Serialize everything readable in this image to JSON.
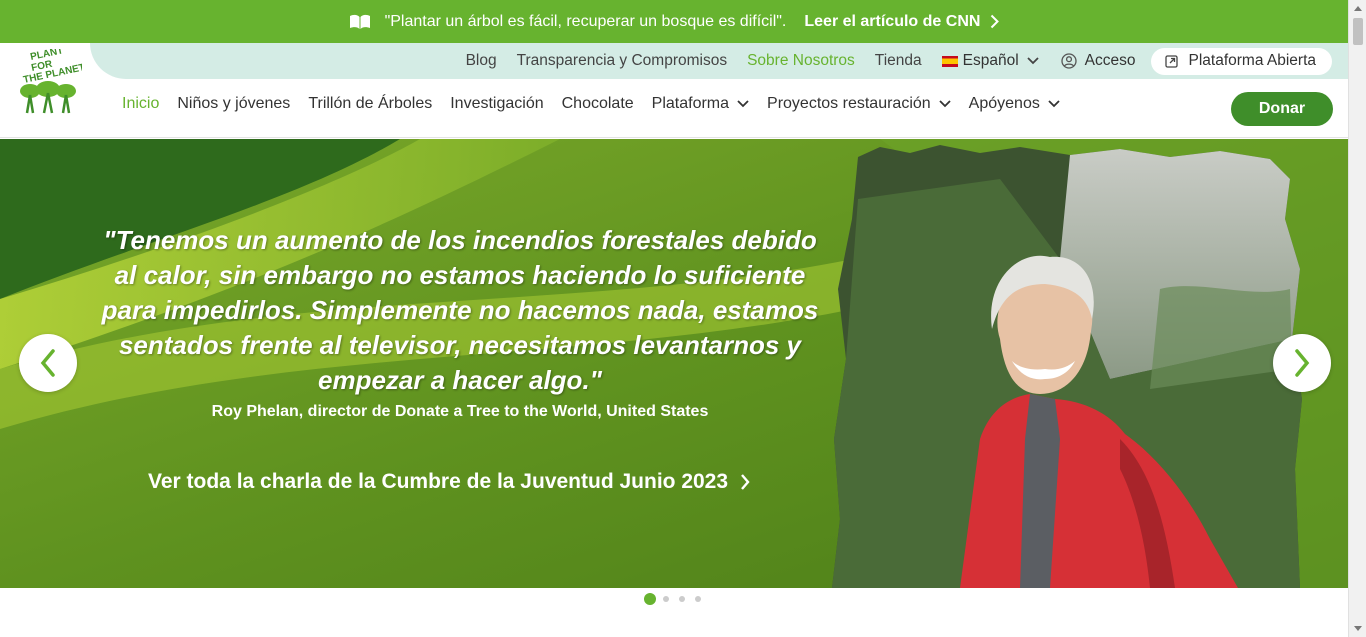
{
  "topbar": {
    "quote": "\"Plantar un árbol es fácil, recuperar un bosque es difícil\".",
    "cta": "Leer el artículo de CNN"
  },
  "header": {
    "logo_text": "PLANT FOR THE PLANET",
    "utility": {
      "blog": "Blog",
      "transparency": "Transparencia y Compromisos",
      "about": "Sobre Nosotros",
      "shop": "Tienda",
      "language": "Español",
      "login": "Acceso",
      "platform": "Plataforma Abierta"
    },
    "nav": {
      "home": "Inicio",
      "kids": "Niños y jóvenes",
      "trillion": "Trillón de Árboles",
      "research": "Investigación",
      "chocolate": "Chocolate",
      "platform": "Plataforma",
      "projects": "Proyectos restauración",
      "support": "Apóyenos"
    },
    "donate": "Donar"
  },
  "hero": {
    "quote_lines": [
      "\"Tenemos un aumento de los incendios forestales debido",
      "al calor, sin embargo no estamos haciendo lo suficiente",
      "para impedirlos. Simplemente no hacemos nada, estamos",
      "sentados frente al televisor, necesitamos levantarnos y",
      "empezar a hacer algo.\""
    ],
    "attribution": "Roy Phelan, director de Donate a Tree to the World, United States",
    "link": "Ver toda la charla de la Cumbre de la Juventud Junio 2023"
  },
  "carousel": {
    "slides": 4,
    "active": 1
  },
  "colors": {
    "brand_green": "#67b32f",
    "donate_green": "#3f8e2a",
    "mint": "#d4ece5"
  },
  "icons": {
    "book": "book-icon",
    "chevron": "chevron-right-icon",
    "user": "user-icon",
    "external": "external-link-icon"
  }
}
